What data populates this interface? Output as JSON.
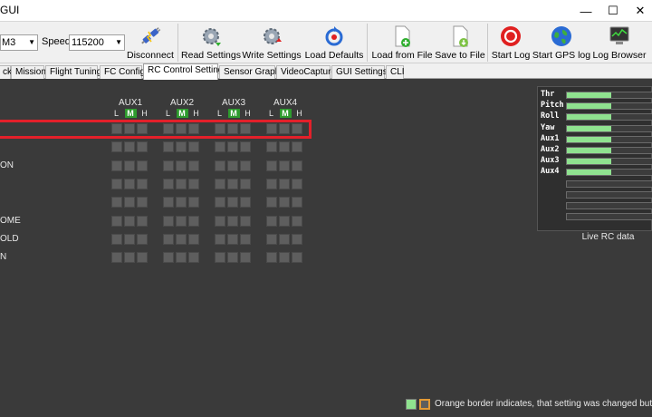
{
  "window": {
    "title": "GUI",
    "controls": {
      "minimize": "—",
      "maximize": "☐",
      "close": "✕"
    }
  },
  "toolbar": {
    "port_value": "M3",
    "baud_label": "Speed",
    "baud_value": "115200",
    "buttons": [
      {
        "label": "Disconnect",
        "icon": "plug-disconnect-icon"
      },
      {
        "label": "Read Settings",
        "icon": "gear-read-icon"
      },
      {
        "label": "Write Settings",
        "icon": "gear-write-icon"
      },
      {
        "label": "Load Defaults",
        "icon": "load-defaults-icon"
      },
      {
        "label": "Load from File",
        "icon": "load-file-icon"
      },
      {
        "label": "Save to File",
        "icon": "save-file-icon"
      },
      {
        "label": "Start Log",
        "icon": "record-icon"
      },
      {
        "label": "Start GPS log",
        "icon": "globe-icon"
      },
      {
        "label": "Log Browser",
        "icon": "monitor-icon"
      }
    ],
    "colors": {
      "record": "#e02020",
      "green": "#2fae2f",
      "blue": "#2a6bd4"
    }
  },
  "tabs": [
    "ck",
    "Mission",
    "Flight Tuning",
    "FC Config",
    "RC Control Settings",
    "Sensor Graph",
    "VideoCapture",
    "GUI Settings",
    "CLI"
  ],
  "active_tab": "RC Control Settings",
  "aux": {
    "headers": [
      "AUX1",
      "AUX2",
      "AUX3",
      "AUX4"
    ],
    "positions": {
      "l": "L",
      "m": "M",
      "h": "H"
    }
  },
  "modes": [
    "",
    "",
    "ON",
    "",
    "",
    "OME",
    "OLD",
    "N"
  ],
  "live_rc": {
    "caption": "Live RC data",
    "channels": [
      {
        "name": "Thr",
        "value": 0.5
      },
      {
        "name": "Pitch",
        "value": 0.5
      },
      {
        "name": "Roll",
        "value": 0.5
      },
      {
        "name": "Yaw",
        "value": 0.5
      },
      {
        "name": "Aux1",
        "value": 0.5
      },
      {
        "name": "Aux2",
        "value": 0.5
      },
      {
        "name": "Aux3",
        "value": 0.5
      },
      {
        "name": "Aux4",
        "value": 0.5
      },
      {
        "name": "",
        "value": 0
      },
      {
        "name": "",
        "value": 0
      },
      {
        "name": "",
        "value": 0
      },
      {
        "name": "",
        "value": 0
      }
    ],
    "fill_color": "#8fe28f"
  },
  "legend": {
    "text": "Orange border indicates, that setting was changed but not writ",
    "green": "#8fe28f",
    "orange": "#e39a35"
  },
  "highlight_color": "#e3202a"
}
